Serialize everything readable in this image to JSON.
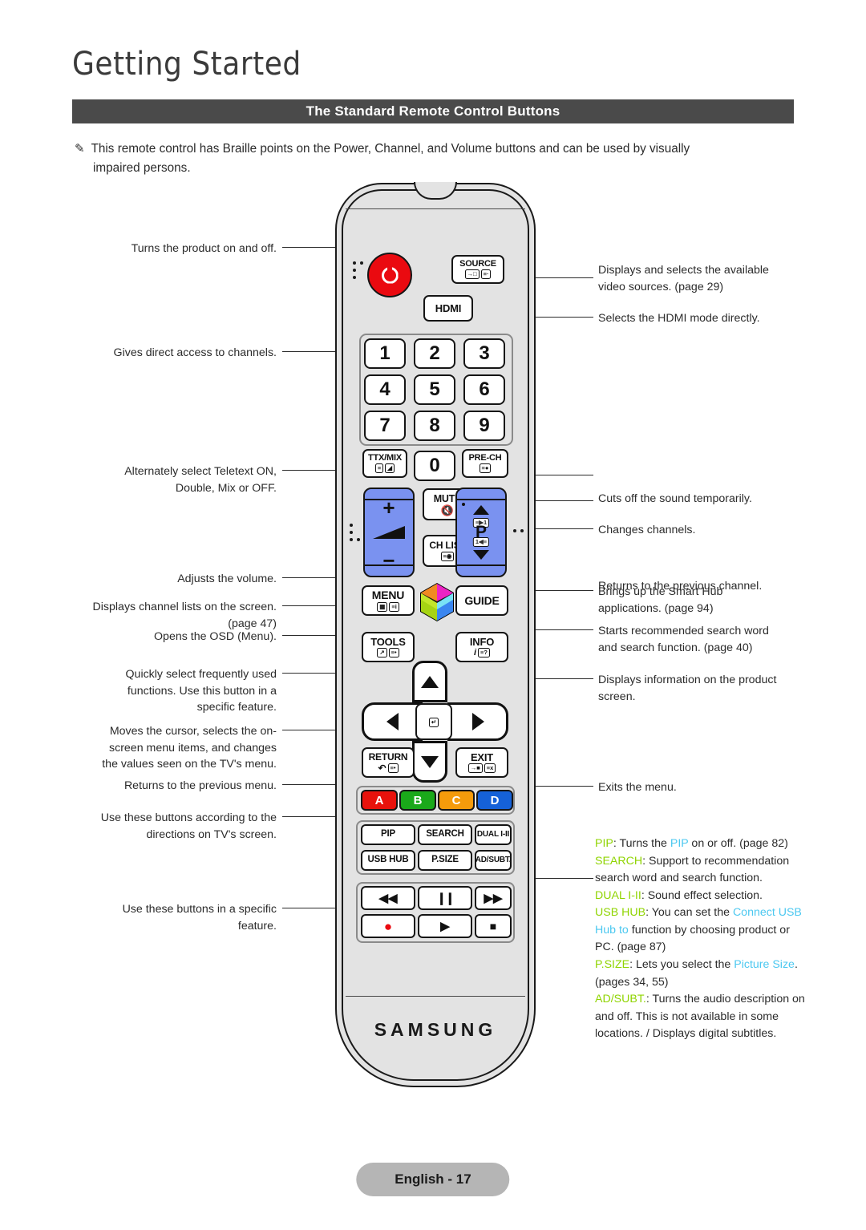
{
  "header": {
    "title": "Getting Started",
    "section_bar": "The Standard Remote Control Buttons"
  },
  "intro_note": {
    "icon": "pencil-note-icon",
    "line1": "This remote control has Braille points on the Power, Channel, and Volume buttons and can be used by visually",
    "line2": "impaired persons."
  },
  "annotations_left": [
    {
      "id": "power",
      "text": "Turns the product on and off."
    },
    {
      "id": "numeric",
      "text": "Gives direct access to channels."
    },
    {
      "id": "ttxmix",
      "text": "Alternately select Teletext ON,\nDouble, Mix or OFF."
    },
    {
      "id": "volume",
      "text": "Adjusts the volume."
    },
    {
      "id": "chlist",
      "text": "Displays channel lists on the screen.\n(page 47)"
    },
    {
      "id": "menu",
      "text": "Opens the OSD (Menu)."
    },
    {
      "id": "tools",
      "text": "Quickly select frequently used\nfunctions. Use this button in a\nspecific feature."
    },
    {
      "id": "dpad",
      "text": "Moves the cursor, selects the on-\nscreen menu items, and changes\nthe values seen on the TV's menu."
    },
    {
      "id": "return",
      "text": "Returns to the previous menu."
    },
    {
      "id": "colorkeys",
      "text": "Use these buttons according to the\ndirections on TV's screen."
    },
    {
      "id": "transport",
      "text": "Use these buttons in a specific\nfeature."
    }
  ],
  "annotations_right": [
    {
      "id": "source",
      "text": "Displays and selects the available\nvideo sources. (page 29)"
    },
    {
      "id": "hdmi",
      "text": "Selects the HDMI mode directly."
    },
    {
      "id": "prech",
      "text": "Returns to the previous channel."
    },
    {
      "id": "mute",
      "text": "Cuts off the sound temporarily."
    },
    {
      "id": "channel",
      "text": "Changes channels."
    },
    {
      "id": "smarthub",
      "text": "Brings up the Smart Hub\napplications. (page 94)"
    },
    {
      "id": "guide",
      "text": "Starts recommended search word\nand search function. (page 40)"
    },
    {
      "id": "info",
      "text": "Displays information on the product\nscreen."
    },
    {
      "id": "exit",
      "text": "Exits the menu."
    }
  ],
  "function_key_notes": [
    {
      "key": "PIP",
      "body": ": Turns the ",
      "ref": "PIP",
      "tail": " on or off. (page 82)"
    },
    {
      "key": "SEARCH",
      "body": ": Support to recommendation search word and search function.",
      "ref": "",
      "tail": ""
    },
    {
      "key": "DUAL I-II",
      "body": ": Sound effect selection.",
      "ref": "",
      "tail": ""
    },
    {
      "key": "USB HUB",
      "body": ": You can set the ",
      "ref": "Connect USB Hub to",
      "tail": " function by choosing product or PC. (page 87)"
    },
    {
      "key": "P.SIZE",
      "body": ": Lets you select the ",
      "ref": "Picture Size",
      "tail": ". (pages 34, 55)"
    },
    {
      "key": "AD/SUBT.",
      "body": ": Turns the audio description on and off. This is not available in some locations. / Displays digital subtitles.",
      "ref": "",
      "tail": ""
    }
  ],
  "remote": {
    "brand": "SAMSUNG",
    "power_label": "power-button",
    "source": {
      "label": "SOURCE",
      "icons": "input-arrow-icon list-icon"
    },
    "hdmi": {
      "label": "HDMI"
    },
    "numbers": [
      "1",
      "2",
      "3",
      "4",
      "5",
      "6",
      "7",
      "8",
      "9"
    ],
    "ttxmix": {
      "label": "TTX/MIX"
    },
    "zero": "0",
    "prech": {
      "label": "PRE-CH"
    },
    "mute": {
      "label": "MUTE"
    },
    "chlist": {
      "label": "CH LIST"
    },
    "volume": {
      "plus": "+",
      "minus": "−"
    },
    "channel": {
      "letter": "P"
    },
    "menu": {
      "label": "MENU"
    },
    "guide": {
      "label": "GUIDE"
    },
    "tools": {
      "label": "TOOLS"
    },
    "info": {
      "label": "INFO"
    },
    "return": {
      "label": "RETURN"
    },
    "exit": {
      "label": "EXIT"
    },
    "color_keys": [
      {
        "label": "A",
        "color": "#e8120c"
      },
      {
        "label": "B",
        "color": "#1aa91a"
      },
      {
        "label": "C",
        "color": "#f59b0b"
      },
      {
        "label": "D",
        "color": "#1561d8"
      }
    ],
    "function_keys": [
      "PIP",
      "SEARCH",
      "DUAL I-II",
      "USB HUB",
      "P.SIZE",
      "AD/SUBT."
    ],
    "transport_keys": [
      "rewind-icon",
      "pause-icon",
      "fast-forward-icon",
      "record-icon",
      "play-icon",
      "stop-icon"
    ]
  },
  "footer": {
    "page_label": "English - 17"
  },
  "colors": {
    "section_bar_bg": "#4a4a4a",
    "power_red": "#ea0a10",
    "rocker_blue": "#7a92f0",
    "footer_pill": "#b5b5b5",
    "key_green": "#8fd400",
    "ref_cyan": "#4cc8f0"
  }
}
